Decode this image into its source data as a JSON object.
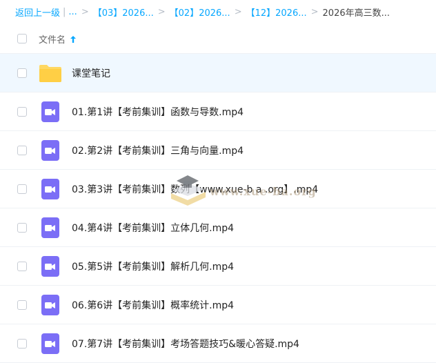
{
  "breadcrumb": {
    "back_label": "返回上一级",
    "pipe": "|",
    "ellipsis": "...",
    "sep": ">",
    "crumbs": [
      "【03】2026...",
      "【02】2026...",
      "【12】2026..."
    ],
    "current": "2026年高三数..."
  },
  "list_header": {
    "name_label": "文件名",
    "sort_icon": "arrow-up-icon"
  },
  "files": [
    {
      "name": "课堂笔记",
      "type": "folder"
    },
    {
      "name": "01.第1讲【考前集训】函数与导数.mp4",
      "type": "video"
    },
    {
      "name": "02.第2讲【考前集训】三角与向量.mp4",
      "type": "video"
    },
    {
      "name": "03.第3讲【考前集训】数列【www.xue-b a .org】.mp4",
      "type": "video"
    },
    {
      "name": "04.第4讲【考前集训】立体几何.mp4",
      "type": "video"
    },
    {
      "name": "05.第5讲【考前集训】解析几何.mp4",
      "type": "video"
    },
    {
      "name": "06.第6讲【考前集训】概率统计.mp4",
      "type": "video"
    },
    {
      "name": "07.第7讲【考前集训】考场答题技巧&暖心答疑.mp4",
      "type": "video"
    }
  ],
  "watermark": {
    "text": "www.xue-ba.org"
  },
  "colors": {
    "accent": "#06a7ff",
    "folder": "#ffd862",
    "video_icon": "#7b6ef6",
    "row_highlight": "#f0f8ff"
  }
}
